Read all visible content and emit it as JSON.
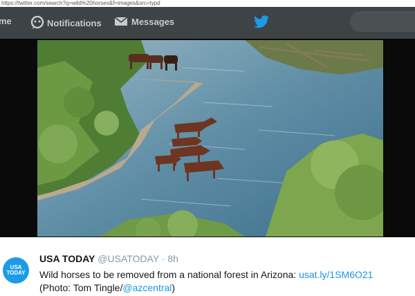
{
  "browser": {
    "url": "https://twitter.com/search?q=wild%20horses&f=images&src=typd"
  },
  "nav": {
    "home_label": "me",
    "notifications_label": "Notifications",
    "messages_label": "Messages"
  },
  "photo": {
    "alt": "Wild horses wading in a river in Arizona"
  },
  "tweet": {
    "avatar_text_line1": "USA",
    "avatar_text_line2": "TODAY",
    "name": "USA TODAY",
    "handle": "@USATODAY",
    "separator": " · ",
    "time": "8h",
    "text": "Wild horses to be removed from a national forest in Arizona: ",
    "link": "usat.ly/1SM6O21",
    "credit_prefix": "(Photo: Tom Tingle/",
    "credit_mention": "@azcentral",
    "credit_suffix": ")"
  },
  "colors": {
    "brand_blue": "#1b9be8",
    "link_blue": "#1b95e0",
    "nav_bg": "#3e4346"
  }
}
